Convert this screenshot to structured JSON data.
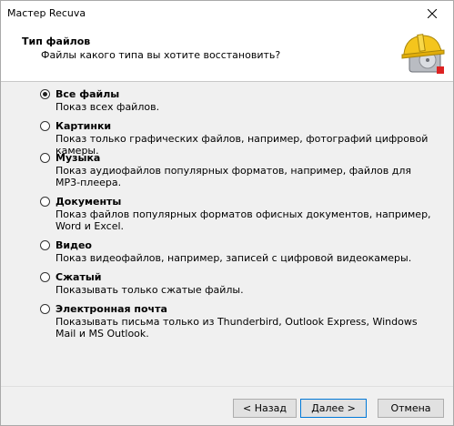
{
  "window": {
    "title": "Мастер Recuva"
  },
  "header": {
    "title": "Тип файлов",
    "subtitle": "Файлы какого типа вы хотите восстановить?"
  },
  "options": [
    {
      "label": "Все файлы",
      "description": "Показ всех файлов.",
      "checked": true
    },
    {
      "label": "Картинки",
      "description": "Показ только графических файлов, например, фотографий цифровой камеры.",
      "checked": false
    },
    {
      "label": "Музыка",
      "description": "Показ аудиофайлов популярных форматов, например, файлов для MP3-плеера.",
      "checked": false
    },
    {
      "label": "Документы",
      "description": "Показ файлов популярных форматов офисных документов, например, Word и Excel.",
      "checked": false
    },
    {
      "label": "Видео",
      "description": "Показ видеофайлов, например, записей с цифровой видеокамеры.",
      "checked": false
    },
    {
      "label": "Сжатый",
      "description": "Показывать только сжатые файлы.",
      "checked": false
    },
    {
      "label": "Электронная почта",
      "description": "Показывать письма только из Thunderbird, Outlook Express, Windows Mail и MS Outlook.",
      "checked": false
    }
  ],
  "buttons": {
    "back": "< Назад",
    "next": "Далее >",
    "cancel": "Отмена"
  },
  "icons": {
    "close": "close-icon",
    "logo": "recuva-hardhat-drive-icon"
  }
}
